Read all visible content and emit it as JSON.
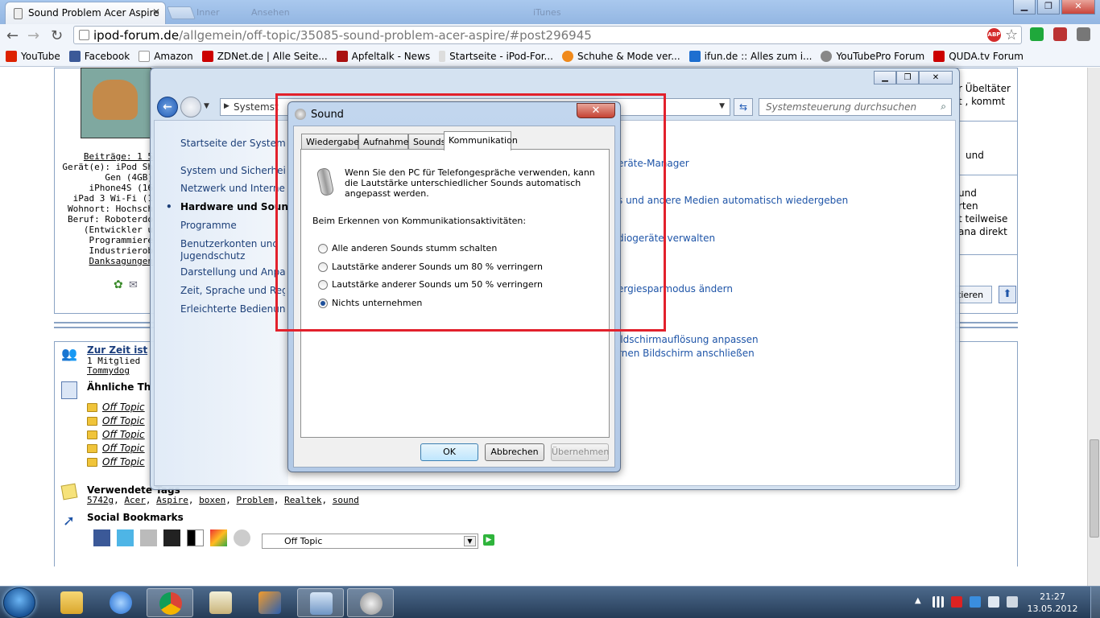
{
  "browser": {
    "tab_title": "Sound Problem Acer Aspire",
    "ghost_tabs": [
      "Inner",
      "Ansehen",
      "iTunes"
    ],
    "url_host": "ipod-forum.de",
    "url_path": "/allgemein/off-topic/35085-sound-problem-acer-aspire/#post296945",
    "bookmarks": [
      "YouTube",
      "Facebook",
      "Amazon",
      "ZDNet.de | Alle Seite...",
      "Apfeltalk - News",
      "Startseite - iPod-For...",
      "Schuhe & Mode ver...",
      "ifun.de :: Alles zum i...",
      "YouTubePro Forum",
      "QUDA.tv Forum"
    ]
  },
  "forum": {
    "profile": {
      "beitraege": "Beiträge: 1 5",
      "geraet": "Gerät(e): iPod Sh",
      "gen": "Gen (4GB)",
      "iphone": "iPhone4S (16",
      "ipad": "iPad 3 Wi-Fi (1",
      "wohnort": "Wohnort: Hochsch",
      "beruf": "Beruf: Roboterdo",
      "entwickler": "(Entwickler u",
      "programmierer": "Programmiere",
      "industrie": "Industrierob",
      "danke": "Danksagungen"
    },
    "right_text": [
      "r Übeltäter",
      "t , kommt",
      "und",
      "und",
      "rten",
      "t teilweise",
      "ana direkt"
    ],
    "zitieren": "tieren",
    "online_heading": "Zur Zeit ist",
    "online_count": "1 Mitglied",
    "online_user": "Tommydog",
    "similar_heading": "Ähnliche Th",
    "similar": [
      "Off Topic",
      "Off Topic",
      "Off Topic",
      "Off Topic",
      "Off Topic"
    ],
    "tags_heading": "Verwendete Tags",
    "tags": [
      "5742g",
      "Acer",
      "Aspire",
      "boxen",
      "Problem",
      "Realtek",
      "sound"
    ],
    "social_heading": "Social Bookmarks",
    "forum_select": "Off Topic"
  },
  "control_panel": {
    "address": "Systemst",
    "search_placeholder": "Systemsteuerung durchsuchen",
    "nav": [
      "Startseite der Systemste",
      "System und Sicherheit",
      "Netzwerk und Internet",
      "Hardware und Sound",
      "Programme",
      "Benutzerkonten und",
      "Jugendschutz",
      "Darstellung und Anpassung",
      "Zeit, Sprache und Region",
      "Erleichterte Bedienung"
    ],
    "links": [
      "eräte-Manager",
      "s und andere Medien automatisch wiedergeben",
      "diogeräte verwalten",
      "ergiesparmodus ändern",
      "ildschirmauflösung anpassen",
      "rnen Bildschirm anschließen"
    ]
  },
  "sound_dialog": {
    "title": "Sound",
    "tabs": [
      "Wiedergabe",
      "Aufnahme",
      "Sounds",
      "Kommunikation"
    ],
    "description": "Wenn Sie den PC für Telefongespräche verwenden, kann die Lautstärke unterschiedlicher Sounds automatisch angepasst werden.",
    "detect_label": "Beim Erkennen von Kommunikationsaktivitäten:",
    "options": [
      {
        "label": "Alle anderen Sounds stumm schalten",
        "selected": false
      },
      {
        "label": "Lautstärke anderer Sounds um 80 % verringern",
        "selected": false
      },
      {
        "label": "Lautstärke anderer Sounds um 50 % verringern",
        "selected": false
      },
      {
        "label": "Nichts unternehmen",
        "selected": true
      }
    ],
    "ok": "OK",
    "cancel": "Abbrechen",
    "apply": "Übernehmen"
  },
  "taskbar": {
    "time": "21:27",
    "date": "13.05.2012"
  },
  "colors": {
    "highlight": "#e2212c",
    "link": "#1f55a8"
  }
}
